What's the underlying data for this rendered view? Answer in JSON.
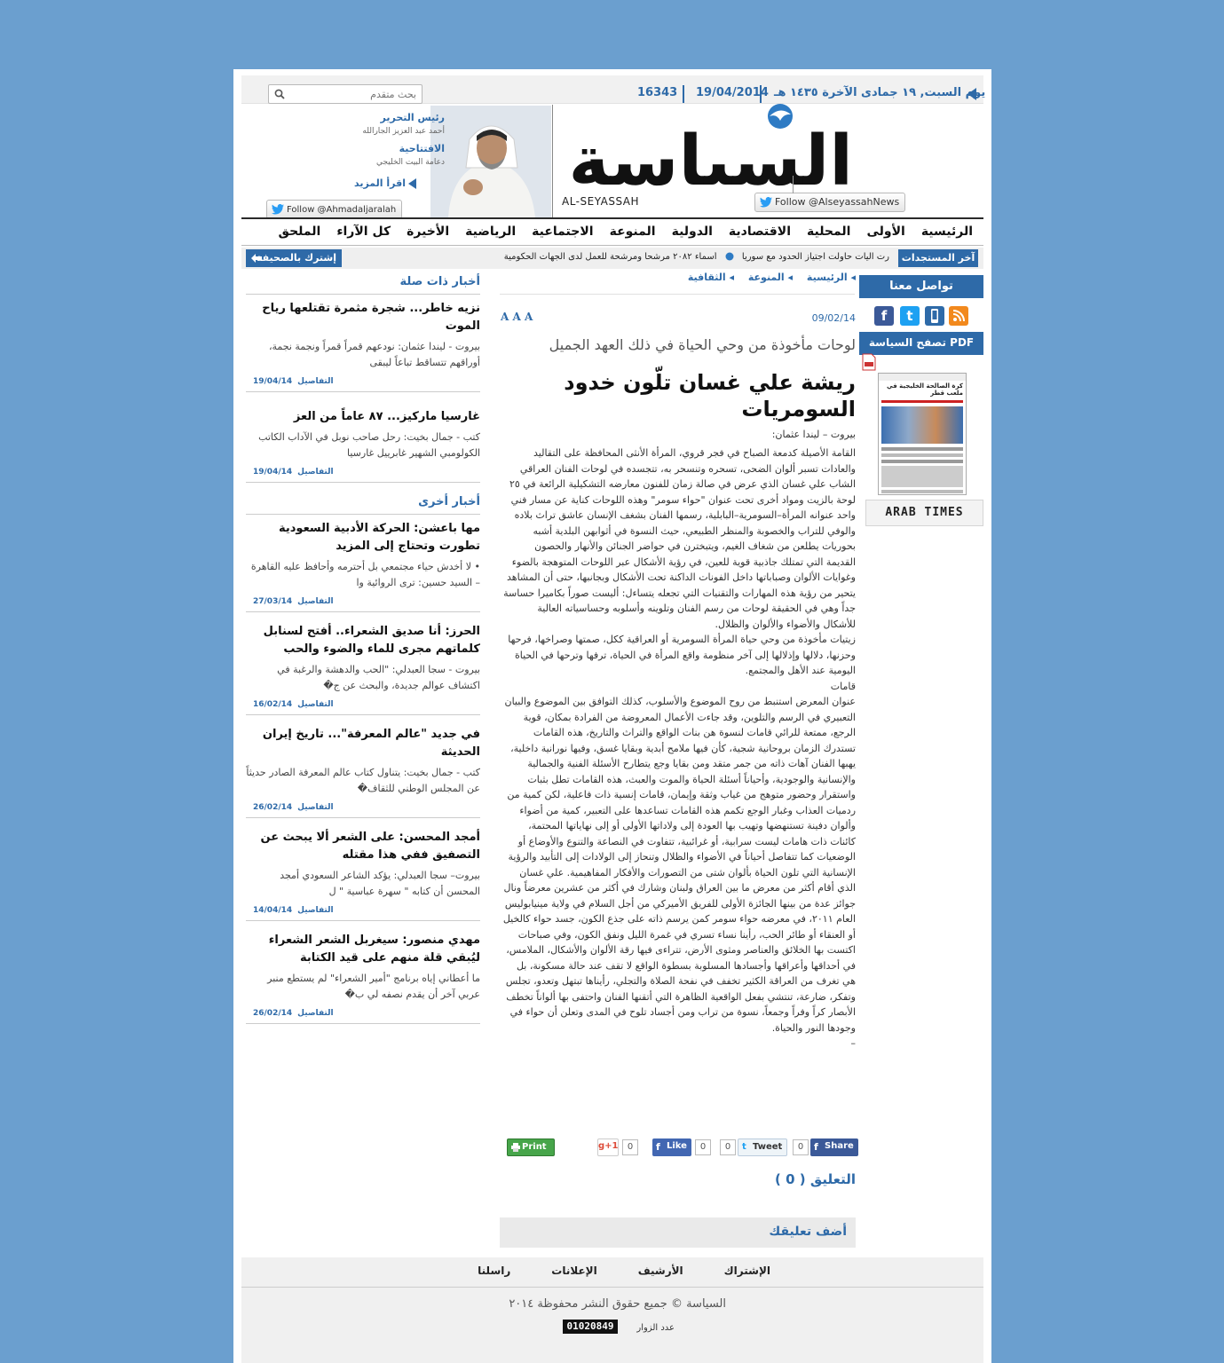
{
  "colors": {
    "brand": "#2e6aa8",
    "background": "#6b9fcf",
    "facebook": "#3b5998",
    "twitter": "#1da1f2",
    "rss": "#f2891d",
    "print": "#47a54a",
    "googleplus": "#dd4b39"
  },
  "header": {
    "search_placeholder": "بحث متقدم",
    "date_hijri": "يوم السبت, ١٩ جمادى الآخرة ١٤٣٥ هـ",
    "date_greg": "19/04/2014",
    "issue_number": "16343",
    "logo_arabic": "السياسة",
    "logo_latin": "AL-SEYASSAH",
    "follow_main": "Follow @AlseyassahNews",
    "editor_title": "رئيس التحرير",
    "editor_name": "أحمد عبد العزيز الجارالله",
    "editorial_title": "الافتتاحية",
    "editorial_name": "دعامة البيت الخليجي",
    "read_more": "اقرأ المزيد",
    "follow_editor": "Follow @Ahmadaljaralah"
  },
  "nav": {
    "items": [
      "الرئيسية",
      "الأولى",
      "المحلية",
      "الاقتصادية",
      "الدولية",
      "المنوعة",
      "الاجتماعية",
      "الرياضية",
      "الأخيرة",
      "كل الآراء",
      "الملحق"
    ]
  },
  "newsbar": {
    "label": "آخر المستجدات",
    "ticker_1": "رت آليات حاولت اجتياز الحدود مع سوريا",
    "ticker_2": "أسماء ٢٠٨٢ مرشحاً ومرشحة للعمل لدى الجهات الحكومية",
    "subscribe": "إشترك بالصحيفة"
  },
  "sidebar": {
    "contact_title": "تواصل معنا",
    "pdf_title": "تصفح السياسة PDF",
    "pdf_headline": "كرة الصالحة الخليجية في ملعب قطر",
    "arab_times": "ARAB TIMES"
  },
  "article": {
    "breadcrumbs": [
      "الرئيسية",
      "المنوعة",
      "الثقافية"
    ],
    "date": "09/02/14",
    "font_size_label": "A A A",
    "subtitle": "لوحات مأخوذة من وحي الحياة في ذلك العهد الجميل",
    "title": "ريشة علي غسان تلّون خدود السومريات",
    "byline": "بيروت – ليندا عثمان:",
    "paragraph_1": "القامة الأصيلة كدمعة الصباح في فجر قروي، المرأة الأنثى المحافظة على التقاليد والعادات تسبر ألوان الضحى، تسحره وتنسحر به، تتجسده في لوحات الفنان العراقي الشاب علي غسان الذي عرض في صالة زمان للفنون معارضه التشكيلية الرائعة في ٢٥ لوحة بالزيت ومواد أخرى تحت عنوان \"حواء سومر\" وهذه اللوحات كناية عن مسار فني واحد عنوانه المرأة–السومرية–البابلية، رسمها الفنان بشغف الإنسان عاشق تراث بلاده والوفي للتراب والخصوبة والمنظر الطبيعي، حيث النسوة في أثوابهن البلدية أشبه بحوريات يطلعن من شغاف الغيم، ويتبخترن في حواضر الجنائن والأنهار والحصون القديمة التي تمتلك جاذبية قوية للعين، في رؤية الأشكال عبر اللوحات المتوهجة بالضوء وغوايات الألوان وصباباتها داخل الفونات الداكنة تحت الأشكال وبجانبها، حتى أن المشاهد يتحير من رؤية هذه المهارات والتقنيات التي تجعله يتساءل: أليست صوراً بكاميرا حساسة جداً وهي في الحقيقة لوحات من رسم الفنان وتلوينه وأسلوبه وحساسياته العالية للأشكال والأضواء والألوان والظلال.",
    "paragraph_2": "زيتيات مأخوذة من وحي حياة المرأة السومرية أو العراقية ككل، صمتها وصراخها، فرحها وحزنها، دلالها وإذلالها إلى آخر منظومة واقع المرأة في الحياة، ترفها وترحها في الحياة اليومية عند الأهل والمجتمع.",
    "section_heading": "قامات",
    "paragraph_3": "عنوان المعرض استنبط من روح الموضوع والأسلوب، كذلك التوافق بين الموضوع والبيان التعبيري في الرسم والتلوين، وقد جاءت الأعمال المعروضة من الفرادة بمكان، قوية الرجع، ممتعة للرائي قامات لنسوة هن بنات الواقع والتراث والتاريخ، هذه القامات تستدرك الزمان بروحانية شجية، كأن فيها ملامح أبدية وبقايا غسق، وفيها نورانية داخلية، يهبها الفنان آهات ذاته من جمر متقد ومن بقايا وجع يتطارح الأسئلة الفنية والجمالية والإنسانية والوجودية، وأحياناً أسئلة الحياة والموت والعبث، هذه القامات تطل بثبات واستقرار وحضور متوهج من غياب وثقة وإيمان، قامات إنسية ذات فاعلية، لكن كمية من ردميات العذاب وغبار الوجع تكمم هذه القامات تساعدها على التعبير، كمية من أضواء وألوان دفينة تستنهضها وتهيب بها العودة إلى ولاداتها الأولى أو إلى نهاياتها المحتمة، كائنات ذات هامات ليست سرابية، أو غرائبية، تتفاوت في النصاعة والتنوع والأوضاع أو الوضعيات كما تتفاصل أحياناً في الأضواء والظلال وتنحاز إلى الولادات إلى التأبيد والرؤية الإنسانية التي تلون الحياة بألوان شتى من التصورات والأفكار المفاهيمية. علي غسان الذي أقام أكثر من معرض ما بين العراق ولبنان وشارك في أكثر من عشرين معرضاً ونال جوائز عدة من بينها الجائزة الأولى للفريق الأميركي من أجل السلام في ولاية مينيابوليس العام ٢٠١١، في معرضه حواء سومر كمن يرسم ذاته على جذع الكون، جسد حواء كالخيل أو العنقاء أو طائر الحب، رأينا نساء تسري في غمرة الليل ونفق الكون، وفي صباحات اكتست بها الخلائق والعناصر ومثوى الأرض، تتراءى فيها رقة الألوان والأشكال، الملامس، في أحداقها وأعراقها وأجسادها المسلوبة بسطوة الواقع لا تقف عند حالة مسكونة، بل هي تغرف من العراقة الكثير تخفف في نفحة الصلاة والتجلي، رأيناها تبتهل وتعدو، تجلس وتفكر، ضارعة، تنتشي بفعل الواقعية الظاهرة التي أتقنها الفنان واحتفى بها ألواناً تخطف الأبصار كراً وفراً وجمعاً، نسوة من تراب ومن أجساد تلوح في المدى وتعلن أن حواء في وجودها النور والحياة.",
    "end_mark": "–"
  },
  "share": {
    "print": "Print",
    "gplus": "g+1",
    "gplus_count": "0",
    "like": "Like",
    "like_count": "0",
    "tweet": "Tweet",
    "tweet_count": "0",
    "share": "Share",
    "share_count": "0"
  },
  "comments": {
    "title": "التعليق ( 0 )",
    "add": "أضف تعليقك"
  },
  "related": {
    "title": "أخبار ذات صلة",
    "more_label": "التفاصيل",
    "items": [
      {
        "title": "نزيه خاطر... شجرة مثمرة تقتلعها رياح الموت",
        "excerpt": "بيروت - ليندا عثمان: نودعهم قمراً قمراً ونجمة نجمة، أوراقهم تتساقط تباعاً ليبقى",
        "date": "19/04/14"
      },
      {
        "title": "غارسيا ماركيز... ٨٧ عاماً من العز",
        "excerpt": "كتب - جمال بخيت: رحل صاحب نوبل في الآداب الكاتب الكولومبي الشهير غابرييل غارسيا",
        "date": "19/04/14"
      }
    ]
  },
  "other_news": {
    "title": "أخبار أخرى",
    "items": [
      {
        "title": "مها باعشن: الحركة الأدبية السعودية تطورت وتحتاج إلى المزيد",
        "excerpt": "• لا أخدش حياء مجتمعي بل أحترمه وأحافظ عليه القاهرة – السيد حسين: ترى الروائية وا",
        "date": "27/03/14"
      },
      {
        "title": "الحرز: أنا صديق الشعراء.. أفتح لسنابل كلماتهم مجرى للماء والضوء والحب",
        "excerpt": "بيروت - سجا العبدلي: \"الحب والدهشة والرغبة في اكتشاف عوالم جديدة، والبحث عن ج�",
        "date": "16/02/14"
      },
      {
        "title": "في جديد \"عالم المعرفة\"... تاريخ إيران الحديثة",
        "excerpt": "كتب - جمال بخيت: يتناول كتاب عالم المعرفة الصادر حديثاً عن المجلس الوطني للثقاف�",
        "date": "26/02/14"
      },
      {
        "title": "أمجد المحسن: على الشعر ألا يبحث عن التصفيق ففي هذا مقتله",
        "excerpt": "بيروت– سجا العبدلي: يؤكد الشاعر السعودي أمجد المحسن أن كتابه \" سهرة عباسية \" ل",
        "date": "14/04/14"
      },
      {
        "title": "مهدي منصور: سيغربل الشعر الشعراء ليُبقي قلة منهم على قيد الكتابة",
        "excerpt": "ما أعطاني إياه برنامج \"أمير الشعراء\" لم يستطع منبر عربي آخر أن يقدم نصفه لي ب�",
        "date": "26/02/14"
      }
    ]
  },
  "footer": {
    "links": [
      "الإشتراك",
      "الأرشيف",
      "الإعلانات",
      "راسلنا"
    ],
    "copyright": "السياسة © جميع حقوق النشر محفوظة ٢٠١٤",
    "visitors_label": "عدد الزوار",
    "visitors_count": "01020849"
  }
}
